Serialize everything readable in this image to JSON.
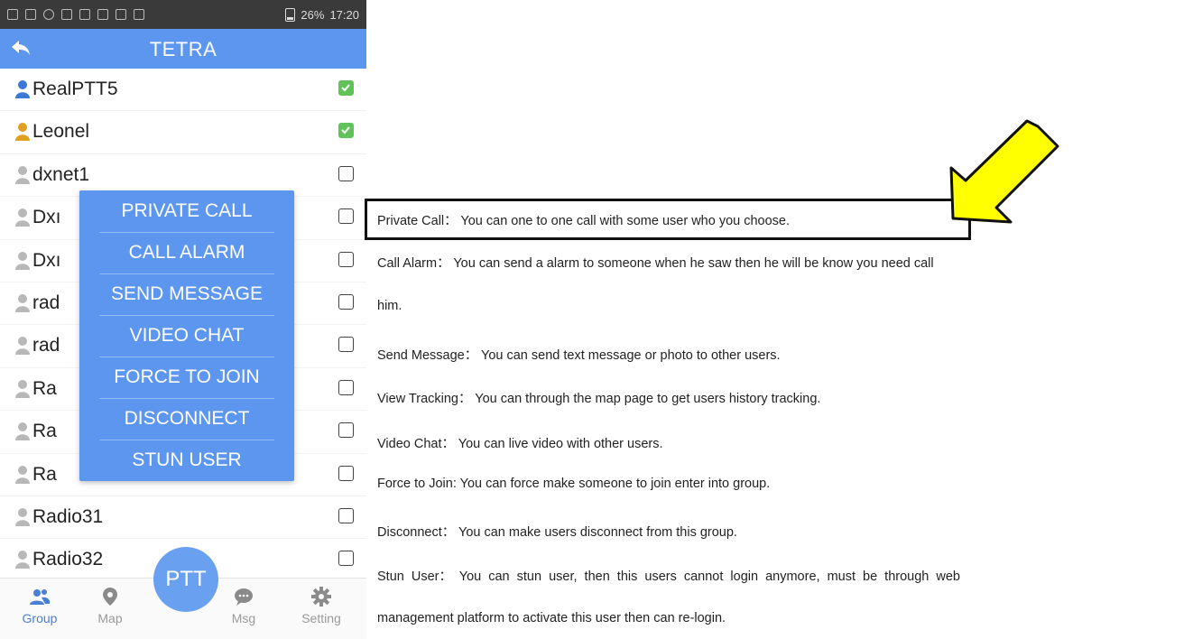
{
  "statusbar": {
    "battery": "26%",
    "time": "17:20"
  },
  "appbar": {
    "title": "TETRA"
  },
  "users": [
    {
      "name": "RealPTT5",
      "checked": true,
      "color": "#3b78d8"
    },
    {
      "name": "Leonel",
      "checked": true,
      "color": "#e0a020"
    },
    {
      "name": "dxnet1",
      "checked": false,
      "color": "#b8b8b8"
    },
    {
      "name": "Dxı",
      "checked": false,
      "color": "#b8b8b8"
    },
    {
      "name": "Dxı",
      "checked": false,
      "color": "#b8b8b8"
    },
    {
      "name": "rad",
      "checked": false,
      "color": "#b8b8b8"
    },
    {
      "name": "rad",
      "checked": false,
      "color": "#b8b8b8"
    },
    {
      "name": "Ra",
      "checked": false,
      "color": "#b8b8b8"
    },
    {
      "name": "Ra",
      "checked": false,
      "color": "#b8b8b8"
    },
    {
      "name": "Ra",
      "checked": false,
      "color": "#b8b8b8"
    },
    {
      "name": "Radio31",
      "checked": false,
      "color": "#b8b8b8"
    },
    {
      "name": "Radio32",
      "checked": false,
      "color": "#b8b8b8"
    }
  ],
  "popup_menu": [
    "PRIVATE CALL",
    "CALL ALARM",
    "SEND MESSAGE",
    "VIDEO CHAT",
    "FORCE TO JOIN",
    "DISCONNECT",
    "STUN USER"
  ],
  "ptt_label": "PTT",
  "tabs": {
    "group": "Group",
    "map": "Map",
    "msg": "Msg",
    "setting": "Setting"
  },
  "descriptions": {
    "private_call": "Private Call： You can one to one call with some user who you choose.",
    "call_alarm_1": "Call Alarm： You can send a alarm to someone when he saw then he will be know you need call",
    "call_alarm_2": "him.",
    "send_message": "Send Message： You can send text message or photo to other users.",
    "view_tracking": "View Tracking： You can through the map page to get users history tracking.",
    "video_chat": "Video Chat： You can live video with other users.",
    "force_to_join": "Force to Join: You can force make someone to join enter into group.",
    "disconnect": "Disconnect： You can make users disconnect from this group.",
    "stun_user_1": "Stun User： You can stun user, then this users cannot login anymore, must be through web",
    "stun_user_2": "management platform to activate this user then can re-login."
  },
  "colors": {
    "accent": "#5d96ee",
    "arrow": "#ffff00",
    "check_on": "#62c25a"
  }
}
